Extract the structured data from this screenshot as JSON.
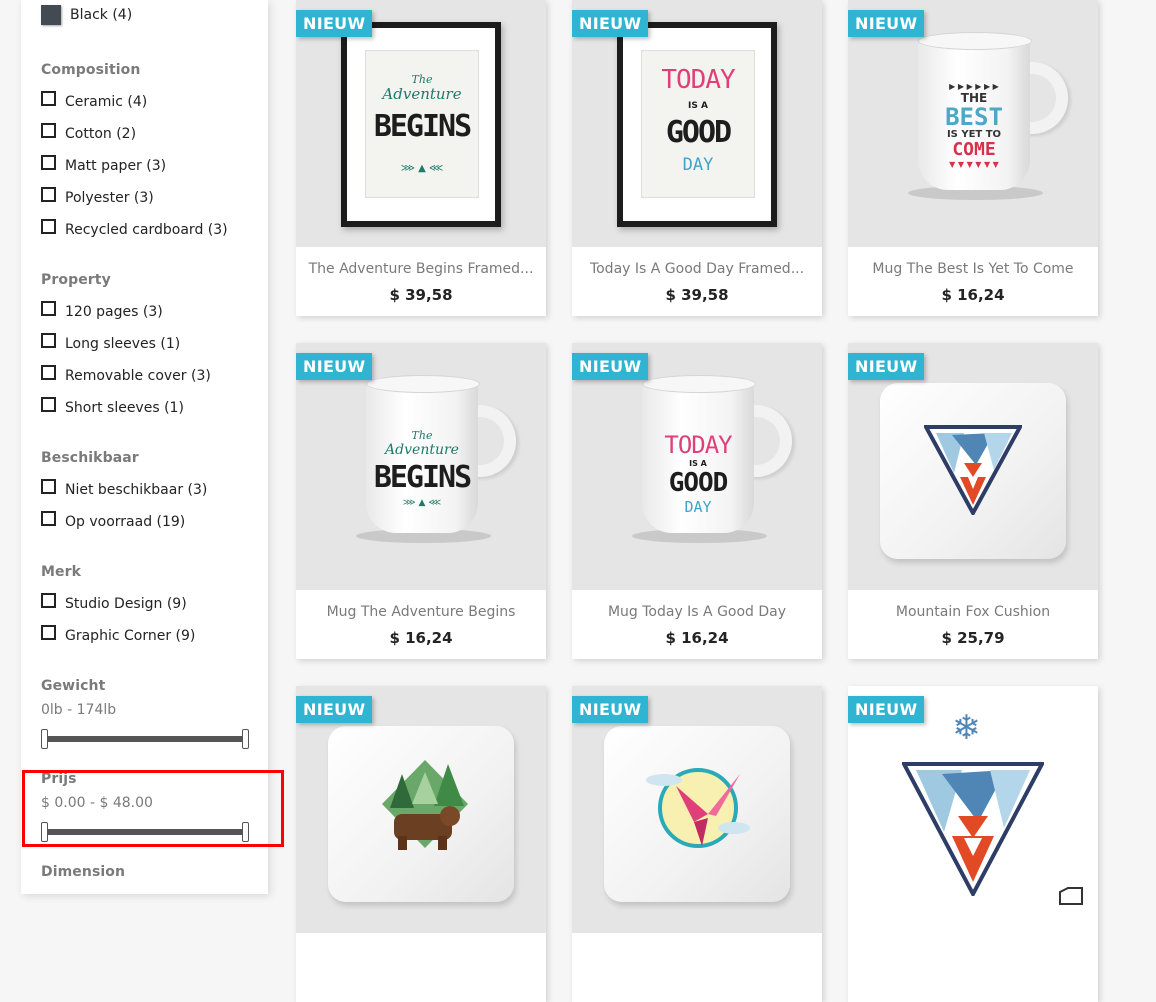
{
  "sidebar": {
    "color": {
      "items": [
        {
          "label": "Black (4)",
          "swatch": "#434a54"
        }
      ]
    },
    "composition": {
      "title": "Composition",
      "items": [
        {
          "label": "Ceramic (4)"
        },
        {
          "label": "Cotton (2)"
        },
        {
          "label": "Matt paper (3)"
        },
        {
          "label": "Polyester (3)"
        },
        {
          "label": "Recycled cardboard (3)"
        }
      ]
    },
    "property": {
      "title": "Property",
      "items": [
        {
          "label": "120 pages (3)"
        },
        {
          "label": "Long sleeves (1)"
        },
        {
          "label": "Removable cover (3)"
        },
        {
          "label": "Short sleeves (1)"
        }
      ]
    },
    "availability": {
      "title": "Beschikbaar",
      "items": [
        {
          "label": "Niet beschikbaar (3)"
        },
        {
          "label": "Op voorraad (19)"
        }
      ]
    },
    "brand": {
      "title": "Merk",
      "items": [
        {
          "label": "Studio Design (9)"
        },
        {
          "label": "Graphic Corner (9)"
        }
      ]
    },
    "weight": {
      "title": "Gewicht",
      "range": "0lb - 174lb"
    },
    "price": {
      "title": "Prijs",
      "range": "$ 0.00 - $ 48.00"
    },
    "dimension": {
      "title": "Dimension"
    }
  },
  "products": [
    {
      "badge": "NIEUW",
      "name": "The Adventure Begins Framed...",
      "price": "$ 39,58",
      "art": {
        "line1": "The",
        "line2": "Adventure",
        "line3": "BEGINS"
      }
    },
    {
      "badge": "NIEUW",
      "name": "Today Is A Good Day Framed...",
      "price": "$ 39,58",
      "art": {
        "line1": "TODAY",
        "line2": "IS A",
        "line3": "GOOD",
        "line4": "DAY"
      }
    },
    {
      "badge": "NIEUW",
      "name": "Mug The Best Is Yet To Come",
      "price": "$ 16,24",
      "art": {
        "line1": "THE",
        "line2": "BEST",
        "line3": "IS YET TO",
        "line4": "COME"
      }
    },
    {
      "badge": "NIEUW",
      "name": "Mug The Adventure Begins",
      "price": "$ 16,24",
      "art": {
        "line1": "The",
        "line2": "Adventure",
        "line3": "BEGINS"
      }
    },
    {
      "badge": "NIEUW",
      "name": "Mug Today Is A Good Day",
      "price": "$ 16,24",
      "art": {
        "line1": "TODAY",
        "line2": "IS A",
        "line3": "GOOD",
        "line4": "DAY"
      }
    },
    {
      "badge": "NIEUW",
      "name": "Mountain Fox Cushion",
      "price": "$ 25,79"
    },
    {
      "badge": "NIEUW",
      "name": "",
      "price": ""
    },
    {
      "badge": "NIEUW",
      "name": "",
      "price": ""
    },
    {
      "badge": "NIEUW",
      "name": "",
      "price": ""
    }
  ],
  "colors": {
    "accent": "#2fb5d2",
    "highlight": "#ff0000",
    "heading": "#7a7a7a"
  }
}
